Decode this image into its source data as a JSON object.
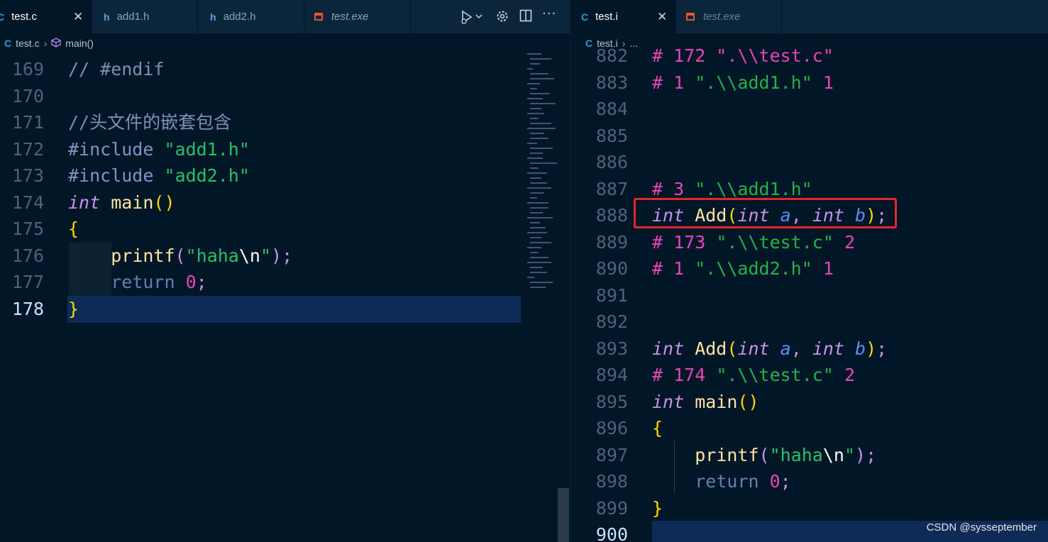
{
  "left_editor": {
    "tabs": [
      {
        "icon": "C",
        "label": "test.c",
        "active": true,
        "close": "✕"
      },
      {
        "icon": "h",
        "label": "add1.h"
      },
      {
        "icon": "h",
        "label": "add2.h"
      },
      {
        "icon": "exe",
        "label": "test.exe"
      }
    ],
    "breadcrumb": {
      "file_icon": "C",
      "file": "test.c",
      "separator": "›",
      "symbol": "main()"
    },
    "lines": [
      {
        "n": "169",
        "tokens": [
          {
            "t": "// #endif",
            "c": "cm2"
          }
        ]
      },
      {
        "n": "170",
        "tokens": []
      },
      {
        "n": "171",
        "tokens": [
          {
            "t": "//头文件的嵌套包含",
            "c": "cm2"
          }
        ]
      },
      {
        "n": "172",
        "tokens": [
          {
            "t": "#include ",
            "c": "pp"
          },
          {
            "t": "\"add1.h\"",
            "c": "str"
          }
        ]
      },
      {
        "n": "173",
        "tokens": [
          {
            "t": "#include ",
            "c": "pp"
          },
          {
            "t": "\"add2.h\"",
            "c": "str"
          }
        ]
      },
      {
        "n": "174",
        "tokens": [
          {
            "t": "int",
            "c": "kw-i"
          },
          {
            "t": " main",
            "c": "fn2"
          },
          {
            "t": "()",
            "c": "par"
          }
        ]
      },
      {
        "n": "175",
        "tokens": [
          {
            "t": "{",
            "c": "par"
          }
        ]
      },
      {
        "n": "176",
        "tokens": [
          {
            "t": "    ",
            "c": "dflt"
          },
          {
            "t": "printf",
            "c": "fn2"
          },
          {
            "t": "(",
            "c": "pun"
          },
          {
            "t": "\"haha",
            "c": "str"
          },
          {
            "t": "\\n",
            "c": "esc"
          },
          {
            "t": "\"",
            "c": "str"
          },
          {
            "t": ")",
            "c": "pun"
          },
          {
            "t": ";",
            "c": "pun"
          }
        ]
      },
      {
        "n": "177",
        "tokens": [
          {
            "t": "    ",
            "c": "dflt"
          },
          {
            "t": "return",
            "c": "ret"
          },
          {
            "t": " 0",
            "c": "mag"
          },
          {
            "t": ";",
            "c": "pun"
          }
        ]
      },
      {
        "n": "178",
        "tokens": [
          {
            "t": "}",
            "c": "par"
          }
        ],
        "current": true
      }
    ]
  },
  "right_editor": {
    "tabs": [
      {
        "icon": "C",
        "label": "test.i",
        "active": true,
        "close": "✕"
      },
      {
        "icon": "exe",
        "label": "test.exe"
      }
    ],
    "breadcrumb": {
      "file_icon": "C",
      "file": "test.i",
      "separator": "›",
      "symbol": "..."
    },
    "lines": [
      {
        "n": "882",
        "tokens": [
          {
            "t": "# 172 \".\\\\test.c\"",
            "c": "mixed-882"
          }
        ]
      },
      {
        "n": "883",
        "tokens": [
          {
            "t": "# ",
            "c": "hash"
          },
          {
            "t": "1 ",
            "c": "mag"
          },
          {
            "t": "\".\\\\add1.h\"",
            "c": "str2"
          },
          {
            "t": " 1",
            "c": "mag"
          }
        ]
      },
      {
        "n": "884",
        "tokens": []
      },
      {
        "n": "885",
        "tokens": []
      },
      {
        "n": "886",
        "tokens": []
      },
      {
        "n": "887",
        "tokens": [
          {
            "t": "# ",
            "c": "hash"
          },
          {
            "t": "3 ",
            "c": "mag"
          },
          {
            "t": "\".\\\\add1.h\"",
            "c": "str2"
          }
        ]
      },
      {
        "n": "888",
        "tokens": [
          {
            "t": "int",
            "c": "kw-i"
          },
          {
            "t": " Add",
            "c": "fn2"
          },
          {
            "t": "(",
            "c": "par"
          },
          {
            "t": "int",
            "c": "kw-i"
          },
          {
            "t": " a",
            "c": "var"
          },
          {
            "t": ", ",
            "c": "pun"
          },
          {
            "t": "int",
            "c": "kw-i"
          },
          {
            "t": " b",
            "c": "var"
          },
          {
            "t": ")",
            "c": "par"
          },
          {
            "t": ";",
            "c": "pun"
          }
        ]
      },
      {
        "n": "889",
        "tokens": [
          {
            "t": "# ",
            "c": "hash"
          },
          {
            "t": "173 ",
            "c": "mag"
          },
          {
            "t": "\".\\\\test.c\"",
            "c": "str2"
          },
          {
            "t": " 2",
            "c": "mag"
          }
        ]
      },
      {
        "n": "890",
        "tokens": [
          {
            "t": "# ",
            "c": "hash"
          },
          {
            "t": "1 ",
            "c": "mag"
          },
          {
            "t": "\".\\\\add2.h\"",
            "c": "str2"
          },
          {
            "t": " 1",
            "c": "mag"
          }
        ]
      },
      {
        "n": "891",
        "tokens": []
      },
      {
        "n": "892",
        "tokens": []
      },
      {
        "n": "893",
        "tokens": [
          {
            "t": "int",
            "c": "kw-i"
          },
          {
            "t": " Add",
            "c": "fn2"
          },
          {
            "t": "(",
            "c": "par"
          },
          {
            "t": "int",
            "c": "kw-i"
          },
          {
            "t": " a",
            "c": "var"
          },
          {
            "t": ", ",
            "c": "pun"
          },
          {
            "t": "int",
            "c": "kw-i"
          },
          {
            "t": " b",
            "c": "var"
          },
          {
            "t": ")",
            "c": "par"
          },
          {
            "t": ";",
            "c": "pun"
          }
        ]
      },
      {
        "n": "894",
        "tokens": [
          {
            "t": "# ",
            "c": "hash"
          },
          {
            "t": "174 ",
            "c": "mag"
          },
          {
            "t": "\".\\\\test.c\"",
            "c": "str2"
          },
          {
            "t": " 2",
            "c": "mag"
          }
        ]
      },
      {
        "n": "895",
        "tokens": [
          {
            "t": "int",
            "c": "kw-i"
          },
          {
            "t": " main",
            "c": "fn2"
          },
          {
            "t": "()",
            "c": "par"
          }
        ]
      },
      {
        "n": "896",
        "tokens": [
          {
            "t": "{",
            "c": "par"
          }
        ]
      },
      {
        "n": "897",
        "tokens": [
          {
            "t": "    ",
            "c": "dflt"
          },
          {
            "t": "printf",
            "c": "fn2"
          },
          {
            "t": "(",
            "c": "pun"
          },
          {
            "t": "\"haha",
            "c": "str"
          },
          {
            "t": "\\n",
            "c": "esc"
          },
          {
            "t": "\"",
            "c": "str"
          },
          {
            "t": ")",
            "c": "pun"
          },
          {
            "t": ";",
            "c": "pun"
          }
        ]
      },
      {
        "n": "898",
        "tokens": [
          {
            "t": "    ",
            "c": "dflt"
          },
          {
            "t": "return",
            "c": "ret"
          },
          {
            "t": " 0",
            "c": "mag"
          },
          {
            "t": ";",
            "c": "pun"
          }
        ]
      },
      {
        "n": "899",
        "tokens": [
          {
            "t": "}",
            "c": "par"
          }
        ]
      },
      {
        "n": "900",
        "tokens": [],
        "current": true
      }
    ]
  },
  "toolbar": {
    "run_icon": "run-debug-icon",
    "settings_icon": "gear-icon",
    "split_icon": "split-editor-icon",
    "more_icon": "more-icon"
  },
  "watermark": "CSDN @sysseptember",
  "colors": {
    "highlight_border": "#e5262b",
    "current_line": "#0e2a57"
  }
}
